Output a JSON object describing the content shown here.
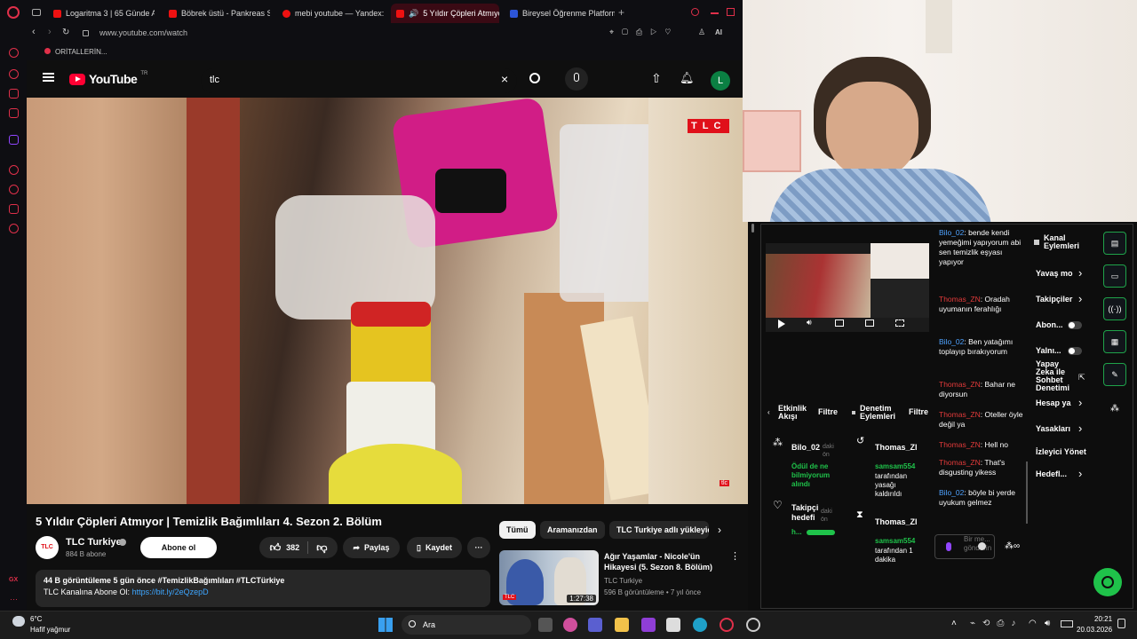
{
  "browser": {
    "tabs": [
      {
        "label": "Logaritma 3 | 65 Günde A"
      },
      {
        "label": "Böbrek üstü - Pankreas S"
      },
      {
        "label": "mebi youtube — Yandex: "
      },
      {
        "label": "5 Yıldır Çöpleri Atmıyor"
      },
      {
        "label": "Bireysel Öğrenme Platform"
      }
    ],
    "url": "www.youtube.com/watch",
    "bookmark": "ORİTALLERİN...",
    "ai_label": "AI"
  },
  "youtube": {
    "logo": "YouTube",
    "region": "TR",
    "search_value": "tlc",
    "avatar_letter": "L",
    "video_badge": "TLC",
    "video_corner": "tlc",
    "title": "5 Yıldır Çöpleri Atmıyor | Temizlik Bağımlıları 4. Sezon 2. Bölüm",
    "channel": {
      "name": "TLC Turkiye",
      "subs": "884 B abone",
      "logo": "TLC"
    },
    "subscribe": "Abone ol",
    "likes": "382",
    "share": "Paylaş",
    "save": "Kaydet",
    "desc_line1": "44 B görüntüleme  5 gün önce  #TemizlikBağımlıları #TLCTürkiye",
    "desc_line2_prefix": "TLC Kanalına Abone Ol: ",
    "desc_link": "https://bit.ly/2eQzepD",
    "chips": [
      "Tümü",
      "Aramanızdan",
      "TLC Turkiye adlı yükleyic"
    ],
    "rec": {
      "title": "Ağır Yaşamlar - Nicole'ün Hikayesi (5. Sezon 8. Bölüm)",
      "channel": "TLC Turkiye",
      "meta": "596 B görüntüleme • 7 yıl önce",
      "duration": "1:27:38"
    }
  },
  "panel": {
    "kanal": "Kanal Eylemleri",
    "menu": [
      "Yavaş mo",
      "Takipçiler",
      "Abon...",
      "Yalnı...",
      "Yapay Zeka ile Sohbet Denetimi",
      "Hesap ya",
      "Yasakları",
      "İzleyici Yönet",
      "Hedefl..."
    ],
    "etkinlik": "Etkinlik Akışı",
    "denetim": "Denetim Eylemleri",
    "filtre": "Filtre",
    "events": [
      {
        "user": "Bilo_02",
        "tag": "daki ön",
        "text": "Ödül de ne bilmiyorum alındı"
      },
      {
        "user": "Takipçi hedefi",
        "tag": "daki ön",
        "text": "h..."
      }
    ],
    "mod_events": [
      {
        "user": "Thomas_Zl",
        "who": "samsam554",
        "text": "tarafından yasağı kaldırıldı"
      },
      {
        "user": "Thomas_Zl",
        "who": "samsam554",
        "text": "tarafından 1 dakika"
      }
    ],
    "chat": [
      {
        "user": "Bilo_02",
        "msg": "bende kendi yemeğimi yapıyorum abi sen temizlik eşyası yapıyor",
        "color": "u1"
      },
      {
        "user": "Thomas_ZN",
        "msg": "Oradah uyumanın ferahlığı",
        "color": "u2"
      },
      {
        "user": "Bilo_02",
        "msg": "Ben yatağımı toplayıp bırakıyorum",
        "color": "u1"
      },
      {
        "user": "Thomas_ZN",
        "msg": "Bahar ne diyorsun",
        "color": "u2"
      },
      {
        "user": "Thomas_ZN",
        "msg": "Oteller öyle değil ya",
        "color": "u2"
      },
      {
        "user": "Thomas_ZN",
        "msg": "Hell no",
        "color": "u2"
      },
      {
        "user": "Thomas_ZN",
        "msg": "That's disgusting yikess",
        "color": "u2"
      },
      {
        "user": "Bilo_02",
        "msg": "böyle bi yerde uyukum gelmez",
        "color": "u1"
      }
    ],
    "chat_input_placeholder": "Bir me... gönderin"
  },
  "taskbar": {
    "weather_temp": "6°C",
    "weather_desc": "Hafif yağmur",
    "search": "Ara",
    "time": "20:21",
    "date": "20.03.2026"
  },
  "colors": {
    "yt_red": "#ff0033",
    "kick_green": "#1fc24a",
    "tab_accent": "#e0304a"
  }
}
